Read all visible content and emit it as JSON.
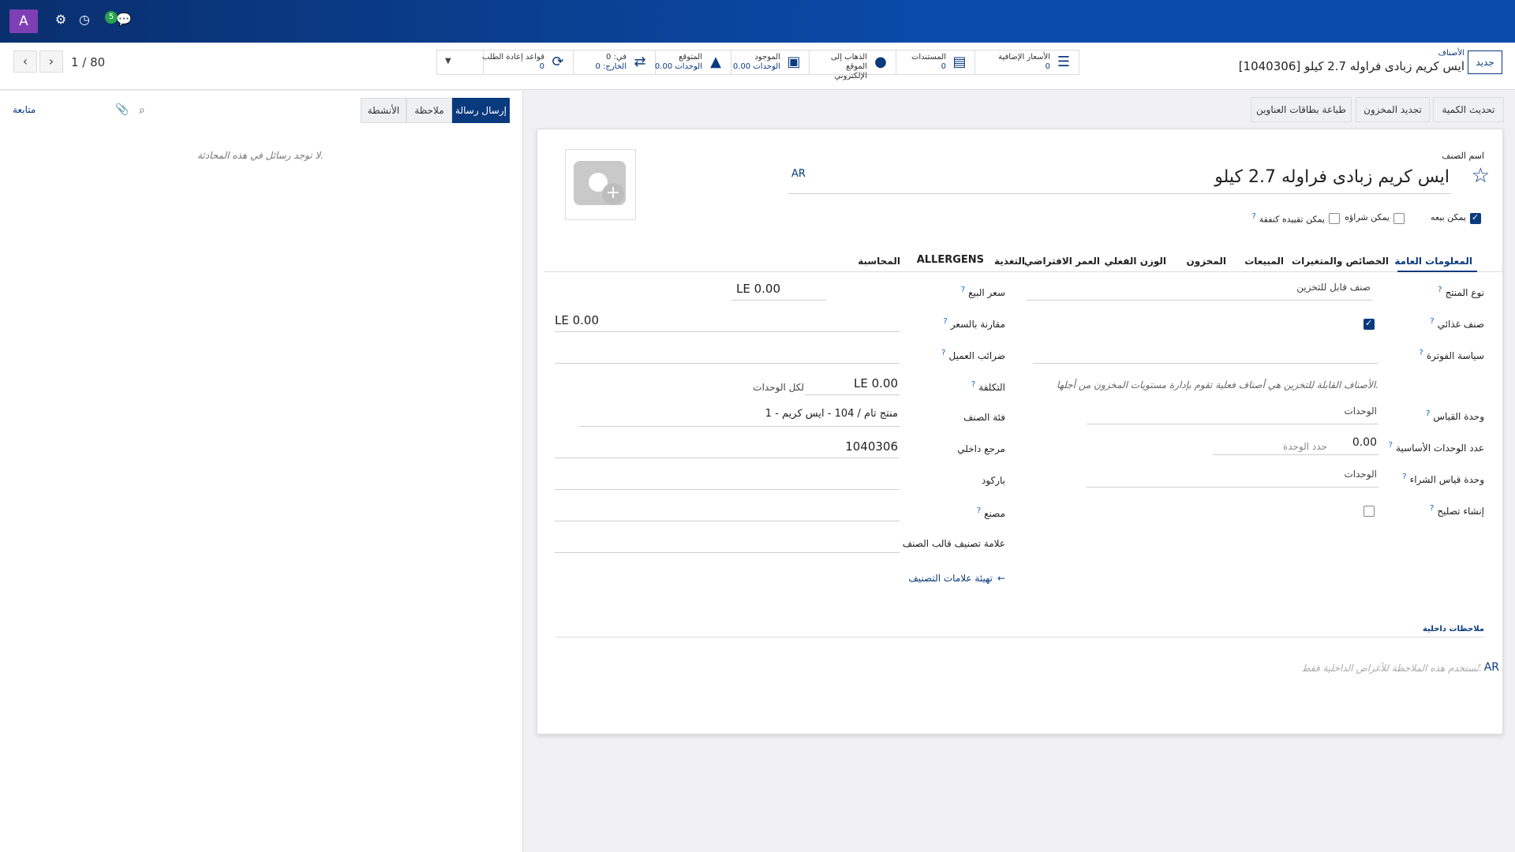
{
  "navbar": {
    "avatar_letter": "A",
    "chat_count": "5"
  },
  "control": {
    "pager": "1 / 80",
    "breadcrumb_parent": "الأصناف",
    "breadcrumb_current": "[1040306] ايس كريم زبادى فراوله 2.7 كيلو",
    "new_label": "جديد",
    "stats": [
      {
        "label": "الأسعار الإضافية",
        "value": "0",
        "icon": "list-icon"
      },
      {
        "label": "المستندات",
        "value": "0",
        "icon": "document-icon"
      },
      {
        "label": "الذهاب إلى الموقع الإلكتروني",
        "value": "",
        "icon": "globe-icon"
      },
      {
        "label": "الموجود",
        "value": "0.00 الوحدات",
        "icon": "cubes-icon"
      },
      {
        "label": "المتوقع",
        "value": "0.00 الوحدات",
        "icon": "area-chart-icon"
      },
      {
        "label": "في: 0",
        "value": "الخارج: 0",
        "icon": "exchange-icon"
      },
      {
        "label": "قواعد إعادة الطلب",
        "value": "0",
        "icon": "refresh-icon"
      }
    ]
  },
  "chatter": {
    "send_message": "إرسال رسالة",
    "note": "ملاحظة",
    "activities": "الأنشطة",
    "follow": "متابعة",
    "no_messages": "لا توجد رسائل في هذه المحادثة."
  },
  "actions": {
    "update_qty": "تحديث الكمية",
    "replenish": "تجديد المخزون",
    "print_labels": "طباعة بطاقات العناوين"
  },
  "product": {
    "name_label": "اسم الصنف",
    "name": "ايس كريم زبادى فراوله 2.7 كيلو",
    "lang": "AR",
    "can_sell": "يمكن بيعه",
    "can_buy": "يمكن شراؤه",
    "can_expense": "يمكن تقييده كنفقة"
  },
  "tabs": [
    "المعلومات العامة",
    "الخصائص والمتغيرات",
    "المبيعات",
    "المخزون",
    "الوزن الفعلي",
    "العمر الافتراضي",
    "التغذية",
    "ALLERGENS",
    "المحاسبة"
  ],
  "right_fields": {
    "product_type_label": "نوع المنتج",
    "product_type": "صنف قابل للتخزين",
    "food_item_label": "صنف غذائي",
    "invoice_policy_label": "سياسة الفوترة",
    "storable_note": "الأصناف القابلة للتخزين هي أصناف فعلية تقوم بإدارة مستويات المخزون من أجلها.",
    "uom_label": "وحدة القياس",
    "uom": "الوحدات",
    "base_units_label": "عدد الوحدات الأساسية",
    "base_units": "0.00",
    "base_units_placeholder": "حدد الوحدة",
    "purchase_uom_label": "وحدة قياس الشراء",
    "purchase_uom": "الوحدات",
    "create_repair_label": "إنشاء تصليح"
  },
  "left_fields": {
    "sale_price_label": "سعر البيع",
    "sale_price": "LE 0.00",
    "compare_price_label": "مقارنة بالسعر",
    "compare_price": "LE 0.00",
    "customer_taxes_label": "ضرائب العميل",
    "cost_label": "التكلفة",
    "cost": "LE 0.00",
    "cost_unit": "لكل الوحدات",
    "category_label": "فئة الصنف",
    "category": "1 - منتج تام / 104 - ايس كريم",
    "internal_ref_label": "مرجع داخلي",
    "internal_ref": "1040306",
    "barcode_label": "باركود",
    "manufacturer_label": "مصنع",
    "template_tags_label": "علامة تصنيف قالب الصنف",
    "configure_tags": "تهيئة علامات التصنيف"
  },
  "notes": {
    "title": "ملاحظات داخلية",
    "placeholder": "تُستخدم هذه الملاحظة للأغراض الداخلية فقط.",
    "lang": "AR"
  },
  "colors": {
    "brand": "#0a3a7e",
    "navbar": "#0a4aa8",
    "avatar": "#7e3fb5"
  }
}
